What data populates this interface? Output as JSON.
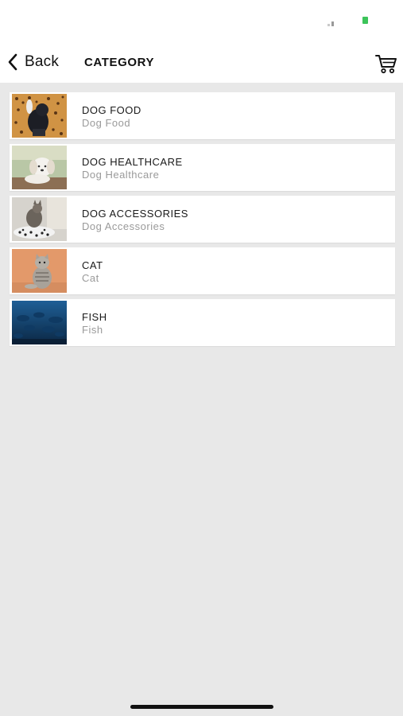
{
  "header": {
    "back_label": "Back",
    "title": "CATEGORY",
    "cart_icon": "cart-icon"
  },
  "status_bar": {
    "battery_color": "#3cc45a"
  },
  "categories": [
    {
      "title": "DOG FOOD",
      "subtitle": "Dog Food",
      "image": "dog-food-image"
    },
    {
      "title": "DOG HEALTHCARE",
      "subtitle": "Dog Healthcare",
      "image": "dog-healthcare-image"
    },
    {
      "title": "DOG ACCESSORIES",
      "subtitle": "Dog Accessories",
      "image": "dog-accessories-image"
    },
    {
      "title": "CAT",
      "subtitle": "Cat",
      "image": "cat-image"
    },
    {
      "title": "FISH",
      "subtitle": "Fish",
      "image": "fish-image"
    }
  ]
}
